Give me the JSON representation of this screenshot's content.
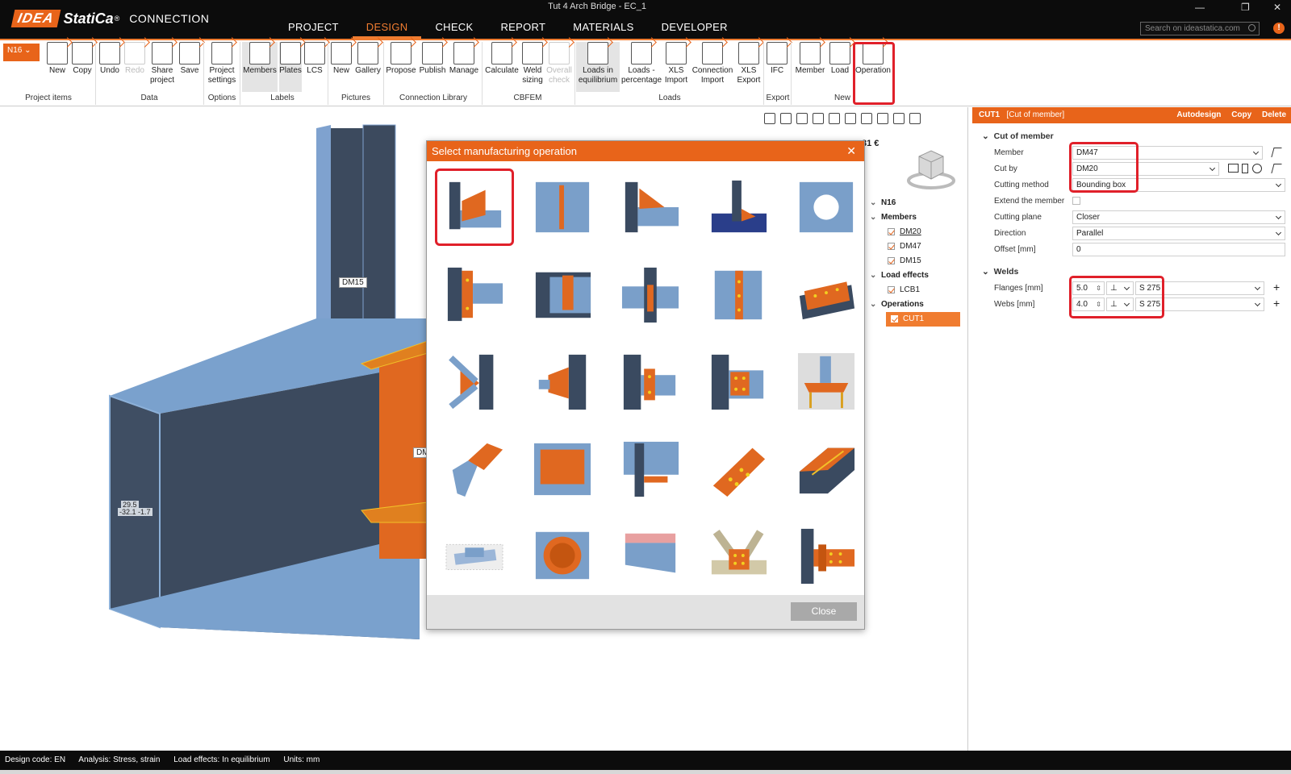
{
  "window": {
    "title": "Tut 4 Arch Bridge - EC_1"
  },
  "brand": {
    "idea": "IDEA",
    "statica": "StatiCa",
    "reg": "®",
    "product": "CONNECTION"
  },
  "menu": [
    "PROJECT",
    "DESIGN",
    "CHECK",
    "REPORT",
    "MATERIALS",
    "DEVELOPER"
  ],
  "search": {
    "placeholder": "Search on ideastatica.com"
  },
  "node_selector": "N16",
  "ribbon": {
    "buttons": [
      "New",
      "Copy",
      "Undo",
      "Redo",
      "Share project",
      "Project settings",
      "Members",
      "Plates",
      "LCS",
      "New",
      "Gallery",
      "Propose",
      "Publish",
      "Manage",
      "Calculate",
      "Weld sizing",
      "Overall check",
      "Loads in equilibrium",
      "Loads - percentage",
      "XLS Import",
      "Connection Import",
      "XLS Export",
      "IFC",
      "Member",
      "Load",
      "Operation"
    ],
    "groups": [
      "Project items",
      "Data",
      "Options",
      "Labels",
      "Pictures",
      "Connection Library",
      "CBFEM",
      "Loads",
      "Export",
      "New"
    ]
  },
  "viewport": {
    "cost": "31 €",
    "labels": [
      "DM15",
      "DM",
      "29.5",
      "-32.1",
      "-1.7"
    ]
  },
  "tree": {
    "root": "N16",
    "members_header": "Members",
    "members": [
      "DM20",
      "DM47",
      "DM15"
    ],
    "load_header": "Load effects",
    "loads": [
      "LCB1"
    ],
    "ops_header": "Operations",
    "ops": [
      "CUT1"
    ]
  },
  "dialog": {
    "title": "Select manufacturing operation",
    "close_label": "Close",
    "operations": [
      "cut-of-member",
      "stiffening-plate",
      "cut-by-plate",
      "base-plate-on-surface",
      "plate-opening",
      "end-plate",
      "fin-plate",
      "web-stiffener",
      "flange-splice",
      "bolted-cover-plate",
      "angle-brace",
      "gusset-plate",
      "cleat-connection",
      "column-splice",
      "anchored-base",
      "pipe-cut",
      "plate",
      "haunch",
      "diagonal-plate",
      "rib-plate",
      "grout-layer",
      "hollow-section",
      "cut-of-beam",
      "truss-node",
      "beam-end-plate"
    ]
  },
  "properties": {
    "header": {
      "name": "CUT1",
      "type": "[Cut of member]",
      "actions": [
        "Autodesign",
        "Copy",
        "Delete"
      ]
    },
    "cut_section": "Cut of member",
    "rows": [
      {
        "label": "Member",
        "value": "DM47"
      },
      {
        "label": "Cut by",
        "value": "DM20"
      },
      {
        "label": "Cutting method",
        "value": "Bounding box"
      },
      {
        "label": "Extend the member",
        "value": ""
      },
      {
        "label": "Cutting plane",
        "value": "Closer"
      },
      {
        "label": "Direction",
        "value": "Parallel"
      },
      {
        "label": "Offset [mm]",
        "value": "0"
      }
    ],
    "welds_section": "Welds",
    "welds": [
      {
        "label": "Flanges [mm]",
        "size": "5.0",
        "material": "S 275"
      },
      {
        "label": "Webs [mm]",
        "size": "4.0",
        "material": "S 275"
      }
    ]
  },
  "status": {
    "design_code": "Design code: EN",
    "analysis": "Analysis: Stress, strain",
    "load_effects": "Load effects: In equilibrium",
    "units": "Units: mm"
  },
  "colors": {
    "accent": "#e8641a",
    "steel": "#7a9fc9",
    "plate": "#e06820",
    "highlight": "#e0202a"
  }
}
